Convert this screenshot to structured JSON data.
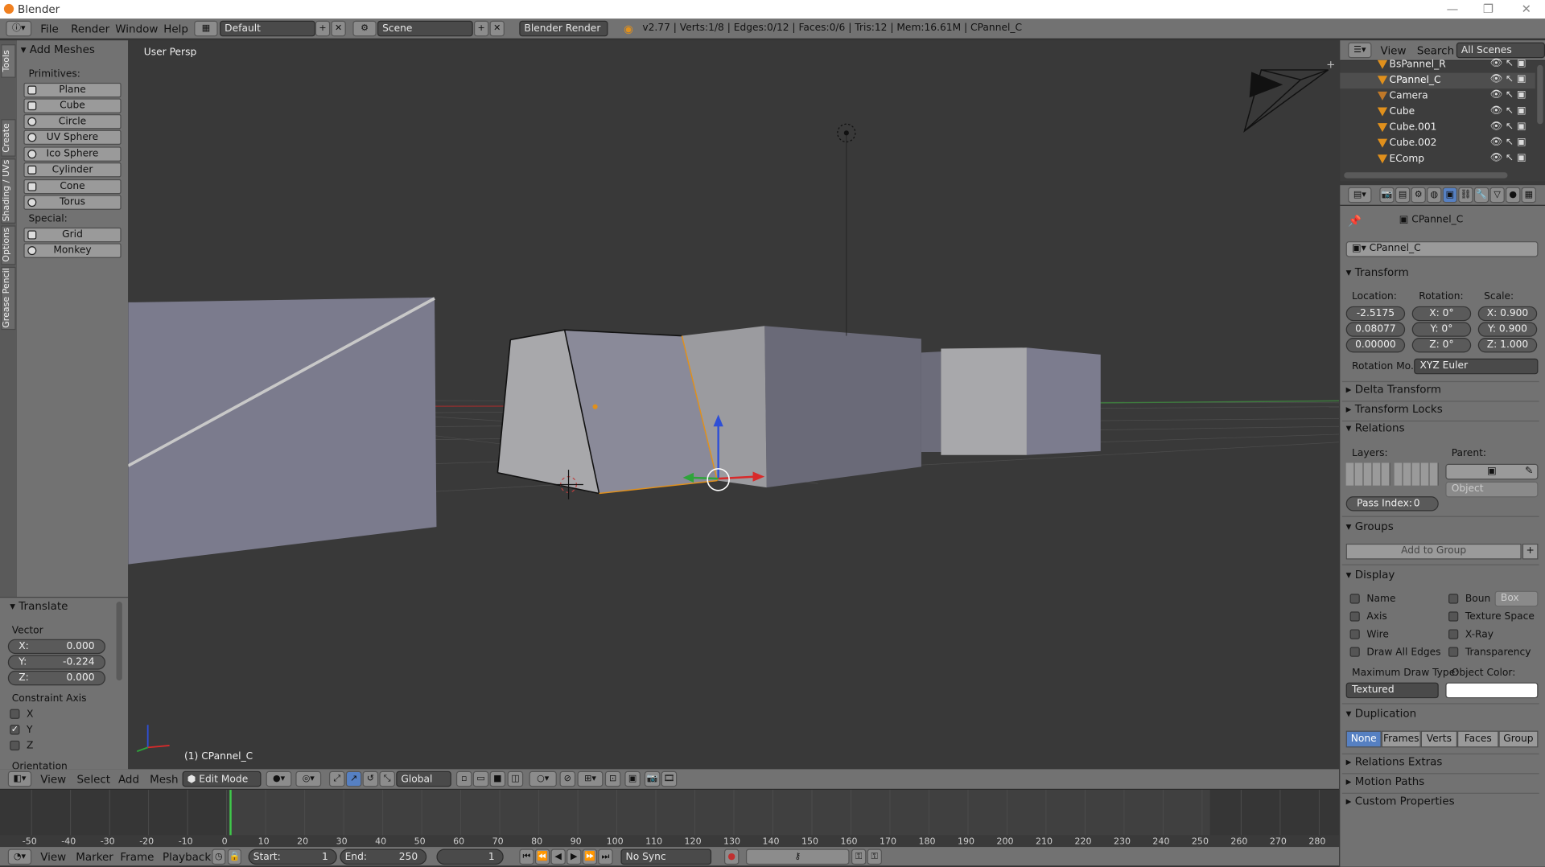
{
  "window": {
    "title": "Blender"
  },
  "info_header": {
    "menus": [
      "File",
      "Render",
      "Window",
      "Help"
    ],
    "screen_layout": "Default",
    "scene": "Scene",
    "render_engine": "Blender Render",
    "stats": "v2.77 | Verts:1/8 | Edges:0/12 | Faces:0/6 | Tris:12 | Mem:16.61M | CPannel_C"
  },
  "tool_tabs": [
    "Tools",
    "Create",
    "Shading / UVs",
    "Options",
    "Grease Pencil"
  ],
  "tool_panel": {
    "title": "Add Meshes",
    "primitives_label": "Primitives:",
    "primitives": [
      "Plane",
      "Cube",
      "Circle",
      "UV Sphere",
      "Ico Sphere",
      "Cylinder",
      "Cone",
      "Torus"
    ],
    "special_label": "Special:",
    "special": [
      "Grid",
      "Monkey"
    ]
  },
  "operator_panel": {
    "title": "Translate",
    "vector_label": "Vector",
    "vector": [
      {
        "axis": "X:",
        "value": "0.000"
      },
      {
        "axis": "Y:",
        "value": "-0.224"
      },
      {
        "axis": "Z:",
        "value": "0.000"
      }
    ],
    "constraint_label": "Constraint Axis",
    "constraints": [
      {
        "label": "X",
        "checked": false
      },
      {
        "label": "Y",
        "checked": true
      },
      {
        "label": "Z",
        "checked": false
      }
    ],
    "orientation_label": "Orientation"
  },
  "viewport": {
    "view_label": "User Persp",
    "object_label": "(1) CPannel_C"
  },
  "view3d_header": {
    "menus": [
      "View",
      "Select",
      "Add",
      "Mesh"
    ],
    "mode": "Edit Mode",
    "orientation": "Global"
  },
  "timeline": {
    "ticks": [
      "-50",
      "-40",
      "-30",
      "-20",
      "-10",
      "0",
      "10",
      "20",
      "30",
      "40",
      "50",
      "60",
      "70",
      "80",
      "90",
      "100",
      "110",
      "120",
      "130",
      "140",
      "150",
      "160",
      "170",
      "180",
      "190",
      "200",
      "210",
      "220",
      "230",
      "240",
      "250",
      "260",
      "270",
      "280"
    ],
    "current_frame": 0,
    "frame_range": [
      1,
      250
    ]
  },
  "timeline_header": {
    "menus": [
      "View",
      "Marker",
      "Frame",
      "Playback"
    ],
    "start": "Start:",
    "start_value": "1",
    "end": "End:",
    "end_value": "250",
    "current": "1",
    "sync": "No Sync"
  },
  "outliner_header": {
    "view": "View",
    "search": "Search",
    "scope": "All Scenes"
  },
  "outliner": [
    "BsPannel_R",
    "CPannel_C",
    "Camera",
    "Cube",
    "Cube.001",
    "Cube.002",
    "EComp"
  ],
  "properties": {
    "breadcrumb": "CPannel_C",
    "object_name": "CPannel_C",
    "transform_title": "Transform",
    "location_label": "Location:",
    "rotation_label": "Rotation:",
    "scale_label": "Scale:",
    "location": [
      "-2.5175",
      "0.08077",
      "0.00000"
    ],
    "rotation": [
      "X:",
      "0°",
      "Y:",
      "0°",
      "Z:",
      "0°"
    ],
    "scale": [
      "X: 0.900",
      "Y: 0.900",
      "Z: 1.000"
    ],
    "rotation_mode_label": "Rotation Mo...",
    "rotation_mode": "XYZ Euler",
    "delta_transform": "Delta Transform",
    "transform_locks": "Transform Locks",
    "relations_title": "Relations",
    "layers_label": "Layers:",
    "parent_label": "Parent:",
    "parent_type": "Object",
    "pass_index_label": "Pass Index:",
    "pass_index": "0",
    "groups_title": "Groups",
    "add_to_group": "Add to Group",
    "display_title": "Display",
    "display_left": [
      "Name",
      "Axis",
      "Wire",
      "Draw All Edges"
    ],
    "display_right": [
      "Boun",
      "Texture Space",
      "X-Ray",
      "Transparency"
    ],
    "bounds_type": "Box",
    "max_draw_label": "Maximum Draw Type:",
    "max_draw": "Textured",
    "object_color_label": "Object Color:",
    "duplication_title": "Duplication",
    "duplication": [
      "None",
      "Frames",
      "Verts",
      "Faces",
      "Group"
    ],
    "relations_extras": "Relations Extras",
    "motion_paths": "Motion Paths",
    "custom_properties": "Custom Properties"
  },
  "colors": {
    "accent": "#5680c2",
    "selection": "#e0901c",
    "header": "#727272",
    "viewport": "#393939"
  }
}
